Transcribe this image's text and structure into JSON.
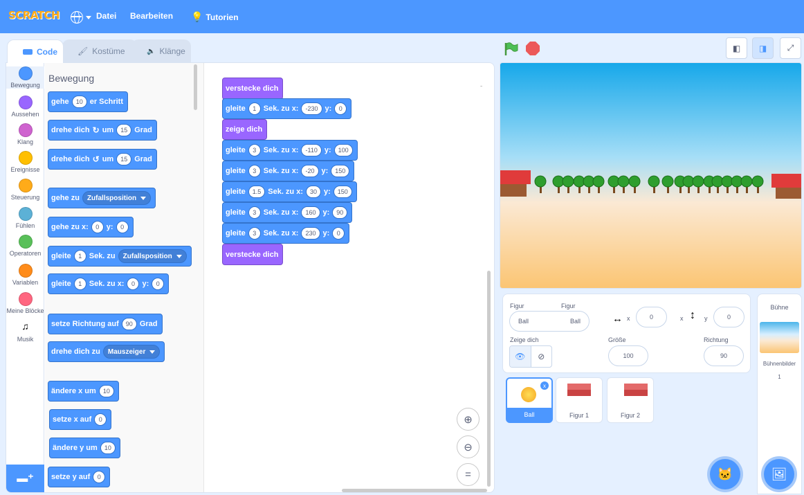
{
  "menu": {
    "logo": "SCRATCH",
    "file": "Datei",
    "edit": "Bearbeiten",
    "tutorials": "Tutorien"
  },
  "tabs": {
    "code": "Code",
    "costumes": "Kostüme",
    "sounds": "Klänge"
  },
  "categories": [
    {
      "label": "Bewegung",
      "color": "#4c97ff"
    },
    {
      "label": "Aussehen",
      "color": "#9966ff"
    },
    {
      "label": "Klang",
      "color": "#cf63cf"
    },
    {
      "label": "Ereignisse",
      "color": "#ffbf00"
    },
    {
      "label": "Steuerung",
      "color": "#ffab19"
    },
    {
      "label": "Fühlen",
      "color": "#5cb1d6"
    },
    {
      "label": "Operatoren",
      "color": "#59c059"
    },
    {
      "label": "Variablen",
      "color": "#ff8c1a"
    },
    {
      "label": "Meine Blöcke",
      "color": "#ff6680"
    },
    {
      "label": "Musik",
      "color": "#0fbd8c"
    }
  ],
  "palette": {
    "title": "Bewegung",
    "move": {
      "a": "gehe",
      "n": "10",
      "b": "er Schritt"
    },
    "turn_right": {
      "a": "drehe dich",
      "b": "um",
      "n": "15",
      "c": "Grad"
    },
    "turn_left": {
      "a": "drehe dich",
      "b": "um",
      "n": "15",
      "c": "Grad"
    },
    "goto": {
      "a": "gehe zu",
      "d": "Zufallsposition"
    },
    "goto_xy": {
      "a": "gehe zu x:",
      "x": "0",
      "b": "y:",
      "y": "0"
    },
    "glide": {
      "a": "gleite",
      "n": "1",
      "b": "Sek. zu",
      "d": "Zufallsposition"
    },
    "glide_xy": {
      "a": "gleite",
      "n": "1",
      "b": "Sek. zu x:",
      "x": "0",
      "c": "y:",
      "y": "0"
    },
    "point_dir": {
      "a": "setze Richtung auf",
      "n": "90",
      "b": "Grad"
    },
    "point_to": {
      "a": "drehe dich zu",
      "d": "Mauszeiger"
    },
    "change_x": {
      "a": "ändere x um",
      "n": "10"
    },
    "set_x": {
      "a": "setze x auf",
      "n": "0"
    },
    "change_y": {
      "a": "ändere y um",
      "n": "10"
    },
    "set_y": {
      "a": "setze y auf",
      "n": "0"
    }
  },
  "script": {
    "hide1": "verstecke dich",
    "show": "zeige dich",
    "hide2": "verstecke dich",
    "gl_a": "gleite",
    "gl_b": "Sek. zu x:",
    "gl_c": "y:",
    "glides": [
      {
        "t": "1",
        "x": "-230",
        "y": "0"
      },
      {
        "t": "3",
        "x": "-110",
        "y": "100"
      },
      {
        "t": "3",
        "x": "-20",
        "y": "150"
      },
      {
        "t": "1.5",
        "x": "30",
        "y": "150"
      },
      {
        "t": "3",
        "x": "160",
        "y": "90"
      },
      {
        "t": "3",
        "x": "230",
        "y": "0"
      }
    ]
  },
  "sprite_info": {
    "sprite_label": "Figur",
    "sprite_label2": "Figur",
    "sprite_placeholder": "Ball",
    "sprite_name": "Ball",
    "x_label": "x",
    "x_value": "0",
    "y_label": "y",
    "y_value": "0",
    "show_label": "Zeige dich",
    "size_label": "Größe",
    "size_value": "100",
    "direction_label": "Richtung",
    "direction_value": "90"
  },
  "sprites": [
    "Ball",
    "Figur 1",
    "Figur 2"
  ],
  "stage_panel": {
    "title": "Bühne",
    "backdrops_label": "Bühnenbilder",
    "backdrops_count": "1"
  }
}
